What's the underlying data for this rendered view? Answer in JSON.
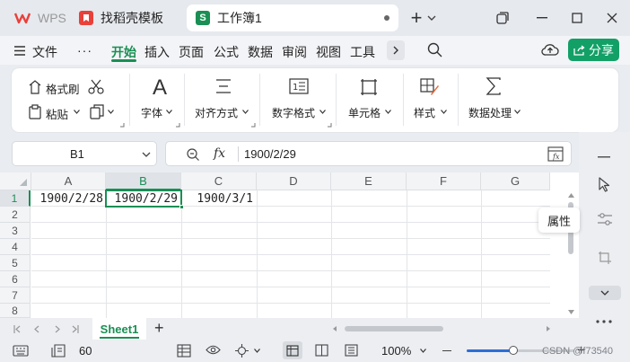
{
  "tabs": [
    {
      "label": "WPS",
      "icon": "wps-logo-icon"
    },
    {
      "label": "找稻壳模板",
      "icon": "docer-logo-icon"
    },
    {
      "label": "工作簿1",
      "icon": "spreadsheet-s-icon",
      "icon_text": "S"
    }
  ],
  "window": {
    "add": "+",
    "min": "—",
    "max": "☐",
    "close": "✕"
  },
  "menu": {
    "file": "文件",
    "more": "···",
    "items": [
      "开始",
      "插入",
      "页面",
      "公式",
      "数据",
      "审阅",
      "视图",
      "工具"
    ],
    "share": "分享"
  },
  "ribbon": {
    "format_painter": "格式刷",
    "paste": "粘贴",
    "font": "字体",
    "align": "对齐方式",
    "number_format": "数字格式",
    "cell": "单元格",
    "style": "样式",
    "data_process": "数据处理",
    "font_icon_letter": "A"
  },
  "formula_bar": {
    "name_box": "B1",
    "fx": "fx",
    "value": "1900/2/29"
  },
  "grid": {
    "columns": [
      "A",
      "B",
      "C",
      "D",
      "E",
      "F",
      "G"
    ],
    "rows": [
      "1",
      "2",
      "3",
      "4",
      "5",
      "6",
      "7",
      "8"
    ],
    "cells": {
      "A1": "1900/2/28",
      "B1": "1900/2/29",
      "C1": "1900/3/1"
    }
  },
  "tooltip": "属性",
  "sheets": {
    "active": "Sheet1",
    "add": "+"
  },
  "status": {
    "page_value": "60",
    "zoom": "100%",
    "watermark": "CSDN @f73540"
  },
  "colors": {
    "accent": "#1a8f54",
    "wps_red": "#e9403a",
    "share_bg": "#13a067"
  }
}
